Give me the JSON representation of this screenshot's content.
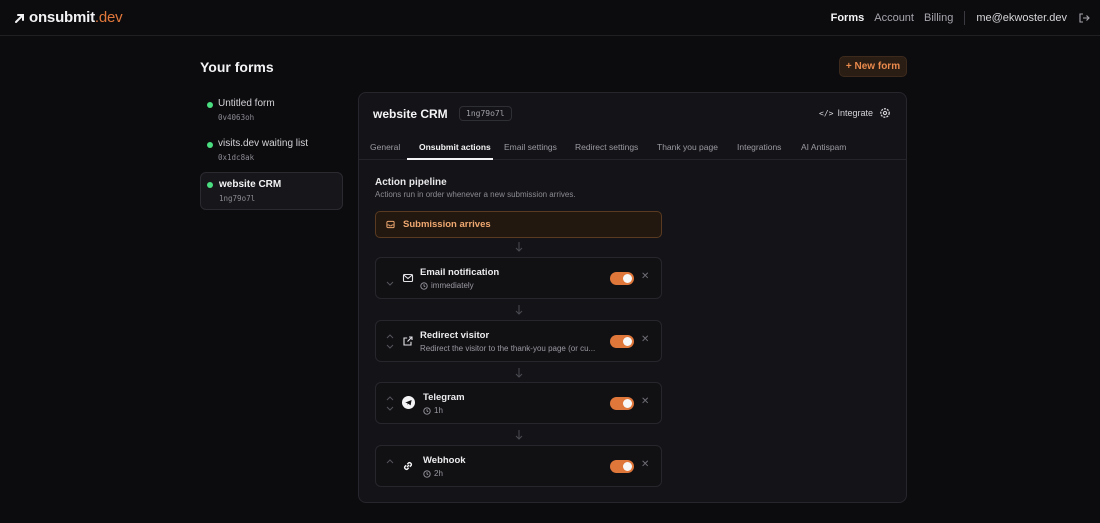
{
  "brand": {
    "name": "onsubmit",
    "tld": ".dev"
  },
  "nav": {
    "forms": "Forms",
    "account": "Account",
    "billing": "Billing",
    "email": "me@ekwoster.dev"
  },
  "page": {
    "title": "Your forms",
    "new_form_label": "+ New form"
  },
  "forms": [
    {
      "name": "Untitled form",
      "code": "0v4063oh",
      "active": false
    },
    {
      "name": "visits.dev waiting list",
      "code": "0x1dc8ak",
      "active": false
    },
    {
      "name": "website CRM",
      "code": "1ng79o7l",
      "active": true
    }
  ],
  "panel": {
    "title": "website CRM",
    "code": "1ng79o7l",
    "integrate_label": "Integrate",
    "tabs": [
      "General",
      "Onsubmit actions",
      "Email settings",
      "Redirect settings",
      "Thank you page",
      "Integrations",
      "AI Antispam"
    ],
    "active_tab": "Onsubmit actions",
    "section_title": "Action pipeline",
    "section_subtitle": "Actions run in order whenever a new submission arrives.",
    "trigger_label": "Submission arrives",
    "actions": [
      {
        "title": "Email notification",
        "subtitle": "immediately",
        "icon": "mail-icon",
        "enabled": true
      },
      {
        "title": "Redirect visitor",
        "subtitle": "Redirect the visitor to the thank-you page (or cu...",
        "icon": "external-link-icon",
        "enabled": true
      },
      {
        "title": "Telegram",
        "subtitle": "1h",
        "icon": "telegram-icon",
        "enabled": true
      },
      {
        "title": "Webhook",
        "subtitle": "2h",
        "icon": "link-icon",
        "enabled": true
      }
    ]
  },
  "colors": {
    "accent": "#e0773a",
    "status_green": "#4ade80",
    "background": "#0c0c0f"
  }
}
